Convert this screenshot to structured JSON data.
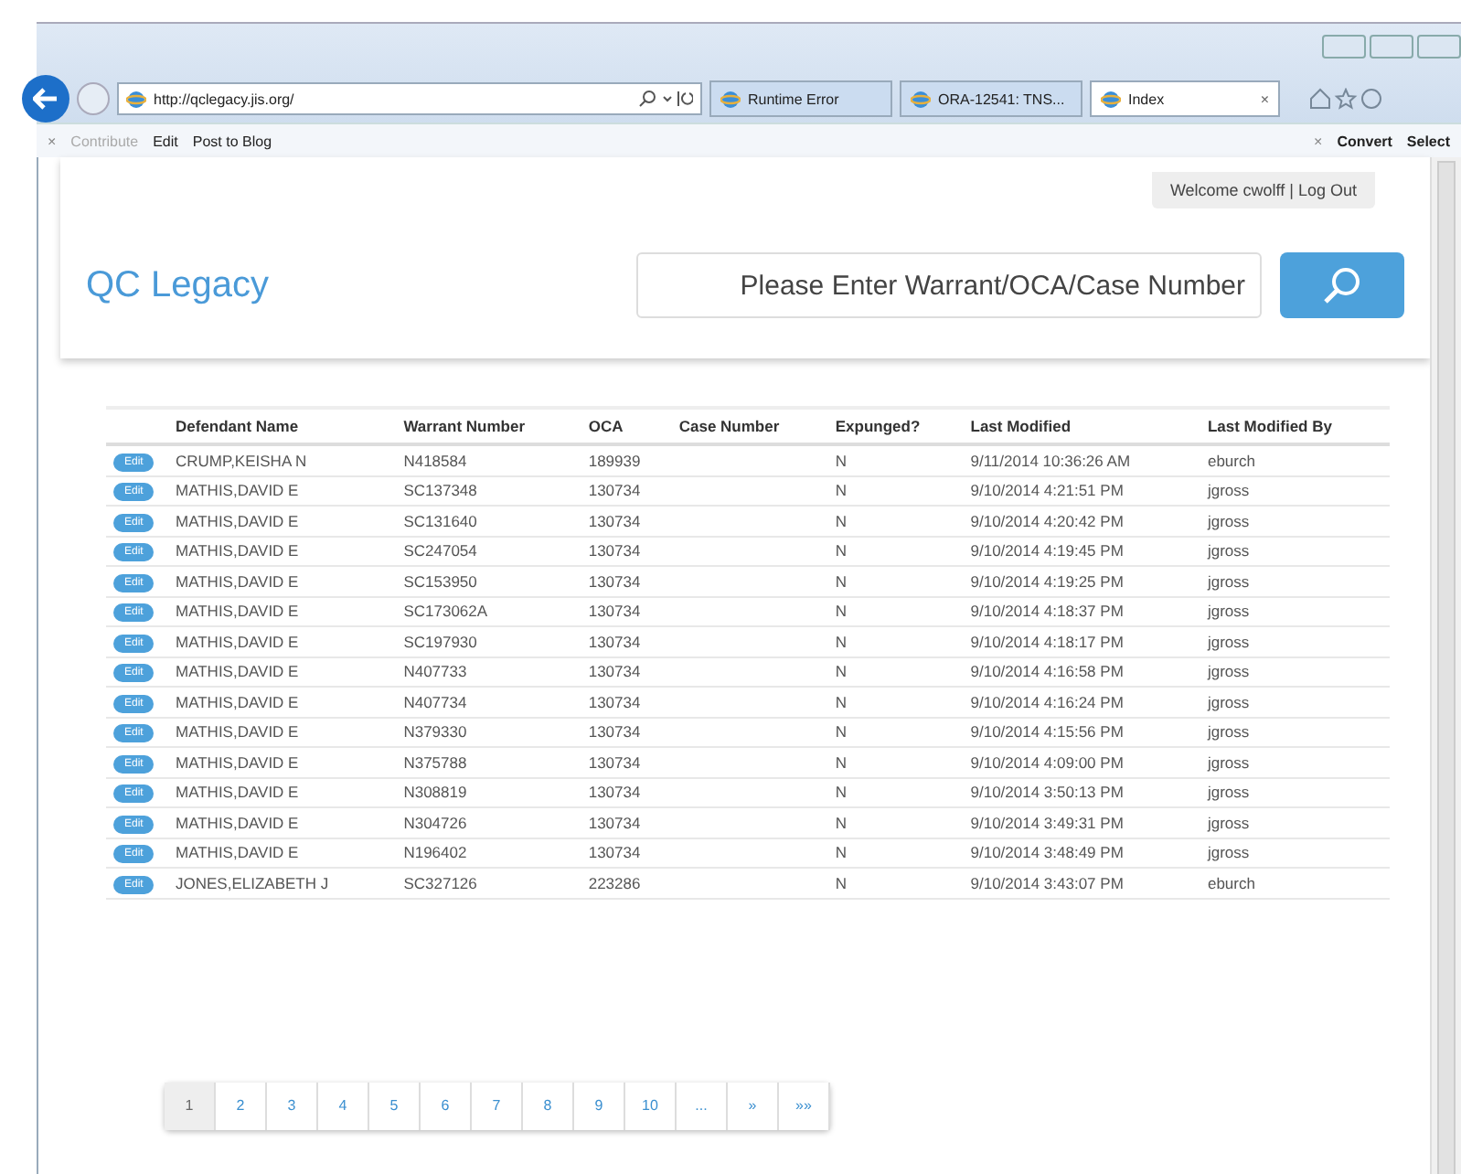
{
  "browser": {
    "address": "http://qclegacy.jis.org/",
    "tabs": [
      {
        "label": "Runtime Error",
        "selected": false
      },
      {
        "label": "ORA-12541: TNS...",
        "selected": false
      },
      {
        "label": "Index",
        "selected": true,
        "close": "×"
      }
    ],
    "toolbar_close": "×",
    "right_close": "×",
    "commands": [
      {
        "label": "Contribute",
        "disabled": true
      },
      {
        "label": "Edit",
        "disabled": false
      },
      {
        "label": "Post to Blog",
        "disabled": false
      }
    ],
    "right_commands": [
      {
        "label": "Convert"
      },
      {
        "label": "Select"
      }
    ]
  },
  "header": {
    "welcome": "Welcome cwolff | Log Out",
    "logo": "QC Legacy",
    "search": {
      "placeholder": "Please Enter Warrant/OCA/Case Number"
    }
  },
  "table": {
    "columns": [
      "Defendant Name",
      "Warrant Number",
      "OCA",
      "Case Number",
      "Expunged?",
      "Last Modified",
      "Last Modified By"
    ],
    "rows": [
      {
        "action": "Edit",
        "cells": [
          "CRUMP,KEISHA N",
          "N418584",
          "189939",
          "",
          "N",
          "9/11/2014 10:36:26 AM",
          "eburch"
        ]
      },
      {
        "action": "Edit",
        "cells": [
          "MATHIS,DAVID E",
          "SC137348",
          "130734",
          "",
          "N",
          "9/10/2014 4:21:51 PM",
          "jgross"
        ]
      },
      {
        "action": "Edit",
        "cells": [
          "MATHIS,DAVID E",
          "SC131640",
          "130734",
          "",
          "N",
          "9/10/2014 4:20:42 PM",
          "jgross"
        ]
      },
      {
        "action": "Edit",
        "cells": [
          "MATHIS,DAVID E",
          "SC247054",
          "130734",
          "",
          "N",
          "9/10/2014 4:19:45 PM",
          "jgross"
        ]
      },
      {
        "action": "Edit",
        "cells": [
          "MATHIS,DAVID E",
          "SC153950",
          "130734",
          "",
          "N",
          "9/10/2014 4:19:25 PM",
          "jgross"
        ]
      },
      {
        "action": "Edit",
        "cells": [
          "MATHIS,DAVID E",
          "SC173062A",
          "130734",
          "",
          "N",
          "9/10/2014 4:18:37 PM",
          "jgross"
        ]
      },
      {
        "action": "Edit",
        "cells": [
          "MATHIS,DAVID E",
          "SC197930",
          "130734",
          "",
          "N",
          "9/10/2014 4:18:17 PM",
          "jgross"
        ]
      },
      {
        "action": "Edit",
        "cells": [
          "MATHIS,DAVID E",
          "N407733",
          "130734",
          "",
          "N",
          "9/10/2014 4:16:58 PM",
          "jgross"
        ]
      },
      {
        "action": "Edit",
        "cells": [
          "MATHIS,DAVID E",
          "N407734",
          "130734",
          "",
          "N",
          "9/10/2014 4:16:24 PM",
          "jgross"
        ]
      },
      {
        "action": "Edit",
        "cells": [
          "MATHIS,DAVID E",
          "N379330",
          "130734",
          "",
          "N",
          "9/10/2014 4:15:56 PM",
          "jgross"
        ]
      },
      {
        "action": "Edit",
        "cells": [
          "MATHIS,DAVID E",
          "N375788",
          "130734",
          "",
          "N",
          "9/10/2014 4:09:00 PM",
          "jgross"
        ]
      },
      {
        "action": "Edit",
        "cells": [
          "MATHIS,DAVID E",
          "N308819",
          "130734",
          "",
          "N",
          "9/10/2014 3:50:13 PM",
          "jgross"
        ]
      },
      {
        "action": "Edit",
        "cells": [
          "MATHIS,DAVID E",
          "N304726",
          "130734",
          "",
          "N",
          "9/10/2014 3:49:31 PM",
          "jgross"
        ]
      },
      {
        "action": "Edit",
        "cells": [
          "MATHIS,DAVID E",
          "N196402",
          "130734",
          "",
          "N",
          "9/10/2014 3:48:49 PM",
          "jgross"
        ]
      },
      {
        "action": "Edit",
        "cells": [
          "JONES,ELIZABETH J",
          "SC327126",
          "223286",
          "",
          "N",
          "9/10/2014 3:43:07 PM",
          "eburch"
        ]
      }
    ]
  },
  "pager": [
    {
      "label": "1",
      "selected": true
    },
    {
      "label": "2",
      "selected": false
    },
    {
      "label": "3",
      "selected": false
    },
    {
      "label": "4",
      "selected": false
    },
    {
      "label": "5",
      "selected": false
    },
    {
      "label": "6",
      "selected": false
    },
    {
      "label": "7",
      "selected": false
    },
    {
      "label": "8",
      "selected": false
    },
    {
      "label": "9",
      "selected": false
    },
    {
      "label": "10",
      "selected": false
    },
    {
      "label": "...",
      "selected": false
    },
    {
      "label": "»",
      "selected": false
    },
    {
      "label": "»»",
      "selected": false
    }
  ]
}
